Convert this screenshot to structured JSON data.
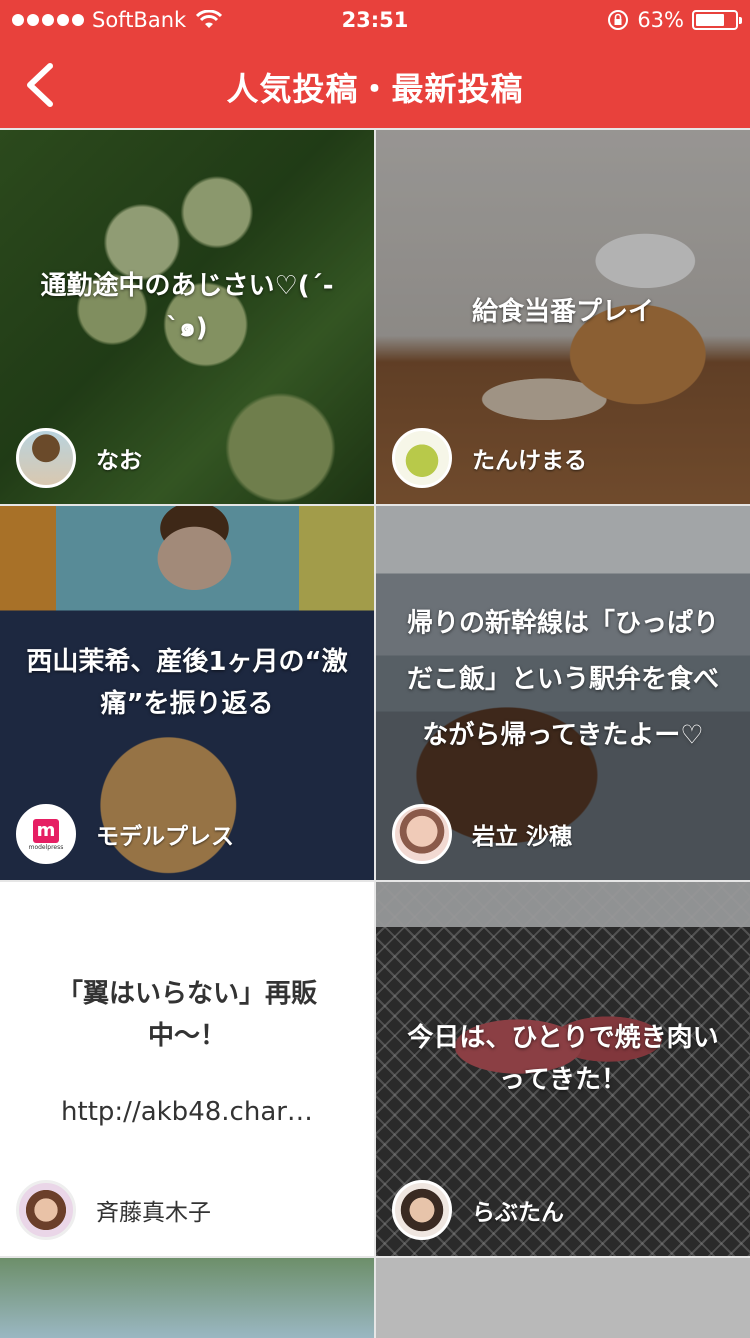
{
  "status_bar": {
    "carrier": "SoftBank",
    "time": "23:51",
    "battery": "63%"
  },
  "nav": {
    "title": "人気投稿・最新投稿"
  },
  "posts": [
    {
      "caption": "通勤途中のあじさい♡(´-`๑)",
      "user": "なお"
    },
    {
      "caption": "給食当番プレイ",
      "user": "たんけまる"
    },
    {
      "caption": "西山茉希、産後1ヶ月の“激痛”を振り返る",
      "user": "モデルプレス",
      "avatar_text": "m",
      "avatar_sub": "modelpress"
    },
    {
      "caption": "帰りの新幹線は「ひっぱりだこ飯」という駅弁を食べながら帰ってきたよー♡",
      "user": "岩立 沙穂"
    },
    {
      "caption": "「翼はいらない」再販中〜！",
      "url": "http://akb48.char…",
      "user": "斉藤真木子"
    },
    {
      "caption": "今日は、ひとりで焼き肉いってきた！",
      "user": "らぶたん"
    }
  ]
}
